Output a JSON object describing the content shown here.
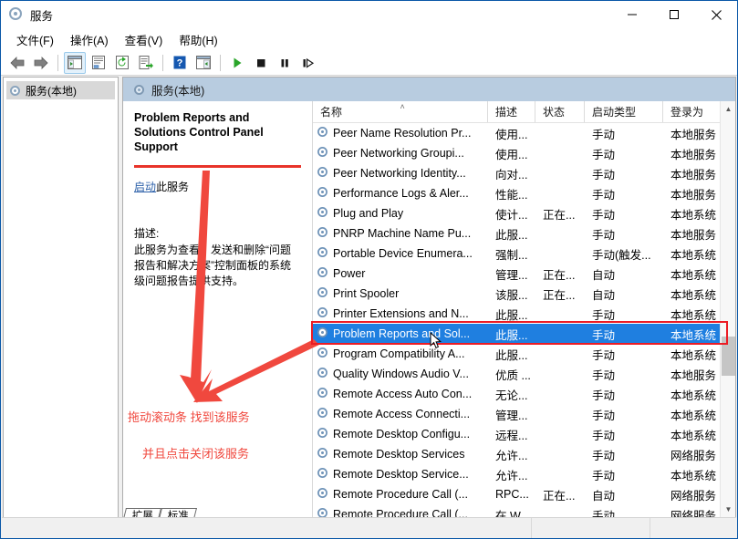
{
  "window": {
    "title": "服务",
    "icon": "gear-icon",
    "minimize_label": "最小化",
    "maximize_label": "最大化",
    "close_label": "关闭"
  },
  "menubar": {
    "items": [
      {
        "label": "文件(F)",
        "name": "menu-file"
      },
      {
        "label": "操作(A)",
        "name": "menu-action"
      },
      {
        "label": "查看(V)",
        "name": "menu-view"
      },
      {
        "label": "帮助(H)",
        "name": "menu-help"
      }
    ]
  },
  "toolbar": {
    "buttons": [
      {
        "name": "back-icon",
        "glyph": "back"
      },
      {
        "name": "forward-icon",
        "glyph": "forward"
      },
      {
        "name": "show-hide-console-tree-icon",
        "glyph": "tree",
        "pressed": true
      },
      {
        "name": "properties-icon",
        "glyph": "properties"
      },
      {
        "name": "refresh-icon",
        "glyph": "refresh"
      },
      {
        "name": "export-list-icon",
        "glyph": "export"
      },
      {
        "name": "help-icon",
        "glyph": "help"
      },
      {
        "name": "show-action-pane-icon",
        "glyph": "actionpane"
      },
      {
        "name": "start-service-icon",
        "glyph": "play"
      },
      {
        "name": "stop-service-icon",
        "glyph": "stop"
      },
      {
        "name": "pause-service-icon",
        "glyph": "pause"
      },
      {
        "name": "restart-service-icon",
        "glyph": "restart"
      }
    ]
  },
  "tree": {
    "root_label": "服务(本地)"
  },
  "pane": {
    "header_label": "服务(本地)"
  },
  "details": {
    "service_title": "Problem Reports and Solutions Control Panel Support",
    "start_link": "启动",
    "start_suffix": "此服务",
    "description_label": "描述:",
    "description_text": "此服务为查看、发送和删除“问题报告和解决方案”控制面板的系统级问题报告提供支持。"
  },
  "list": {
    "columns": [
      {
        "label": "名称",
        "key": "name",
        "sorted": "asc"
      },
      {
        "label": "描述",
        "key": "desc"
      },
      {
        "label": "状态",
        "key": "state"
      },
      {
        "label": "启动类型",
        "key": "start"
      },
      {
        "label": "登录为",
        "key": "logon"
      }
    ],
    "sort_arrow": "˄",
    "rows": [
      {
        "name": "Peer Name Resolution Pr...",
        "desc": "使用...",
        "state": "",
        "start": "手动",
        "logon": "本地服务",
        "selected": false
      },
      {
        "name": "Peer Networking Groupi...",
        "desc": "使用...",
        "state": "",
        "start": "手动",
        "logon": "本地服务",
        "selected": false
      },
      {
        "name": "Peer Networking Identity...",
        "desc": "向对...",
        "state": "",
        "start": "手动",
        "logon": "本地服务",
        "selected": false
      },
      {
        "name": "Performance Logs & Aler...",
        "desc": "性能...",
        "state": "",
        "start": "手动",
        "logon": "本地服务",
        "selected": false
      },
      {
        "name": "Plug and Play",
        "desc": "使计...",
        "state": "正在...",
        "start": "手动",
        "logon": "本地系统",
        "selected": false
      },
      {
        "name": "PNRP Machine Name Pu...",
        "desc": "此服...",
        "state": "",
        "start": "手动",
        "logon": "本地服务",
        "selected": false
      },
      {
        "name": "Portable Device Enumera...",
        "desc": "强制...",
        "state": "",
        "start": "手动(触发...",
        "logon": "本地系统",
        "selected": false
      },
      {
        "name": "Power",
        "desc": "管理...",
        "state": "正在...",
        "start": "自动",
        "logon": "本地系统",
        "selected": false
      },
      {
        "name": "Print Spooler",
        "desc": "该服...",
        "state": "正在...",
        "start": "自动",
        "logon": "本地系统",
        "selected": false
      },
      {
        "name": "Printer Extensions and N...",
        "desc": "此服...",
        "state": "",
        "start": "手动",
        "logon": "本地系统",
        "selected": false
      },
      {
        "name": "Problem Reports and Sol...",
        "desc": "此服...",
        "state": "",
        "start": "手动",
        "logon": "本地系统",
        "selected": true
      },
      {
        "name": "Program Compatibility A...",
        "desc": "此服...",
        "state": "",
        "start": "手动",
        "logon": "本地系统",
        "selected": false
      },
      {
        "name": "Quality Windows Audio V...",
        "desc": "优质 ...",
        "state": "",
        "start": "手动",
        "logon": "本地服务",
        "selected": false
      },
      {
        "name": "Remote Access Auto Con...",
        "desc": "无论...",
        "state": "",
        "start": "手动",
        "logon": "本地系统",
        "selected": false
      },
      {
        "name": "Remote Access Connecti...",
        "desc": "管理...",
        "state": "",
        "start": "手动",
        "logon": "本地系统",
        "selected": false
      },
      {
        "name": "Remote Desktop Configu...",
        "desc": "远程...",
        "state": "",
        "start": "手动",
        "logon": "本地系统",
        "selected": false
      },
      {
        "name": "Remote Desktop Services",
        "desc": "允许...",
        "state": "",
        "start": "手动",
        "logon": "网络服务",
        "selected": false
      },
      {
        "name": "Remote Desktop Service...",
        "desc": "允许...",
        "state": "",
        "start": "手动",
        "logon": "本地系统",
        "selected": false
      },
      {
        "name": "Remote Procedure Call (...",
        "desc": "RPC...",
        "state": "正在...",
        "start": "自动",
        "logon": "网络服务",
        "selected": false
      },
      {
        "name": "Remote Procedure Call (...",
        "desc": "在 W...",
        "state": "",
        "start": "手动",
        "logon": "网络服务",
        "selected": false
      }
    ]
  },
  "tabs": [
    {
      "label": "扩展",
      "name": "tab-extended"
    },
    {
      "label": "标准",
      "name": "tab-standard"
    }
  ],
  "annotations": {
    "line1": "拖动滚动条 找到该服务",
    "line2": "并且点击关闭该服务",
    "color": "#f0483e",
    "highlight_color": "#ec1c24"
  },
  "colors": {
    "selection_blue": "#1f7fe0",
    "pane_header": "#b8cce0",
    "accent_red": "#e8332a",
    "link_blue": "#2b5fa8"
  }
}
